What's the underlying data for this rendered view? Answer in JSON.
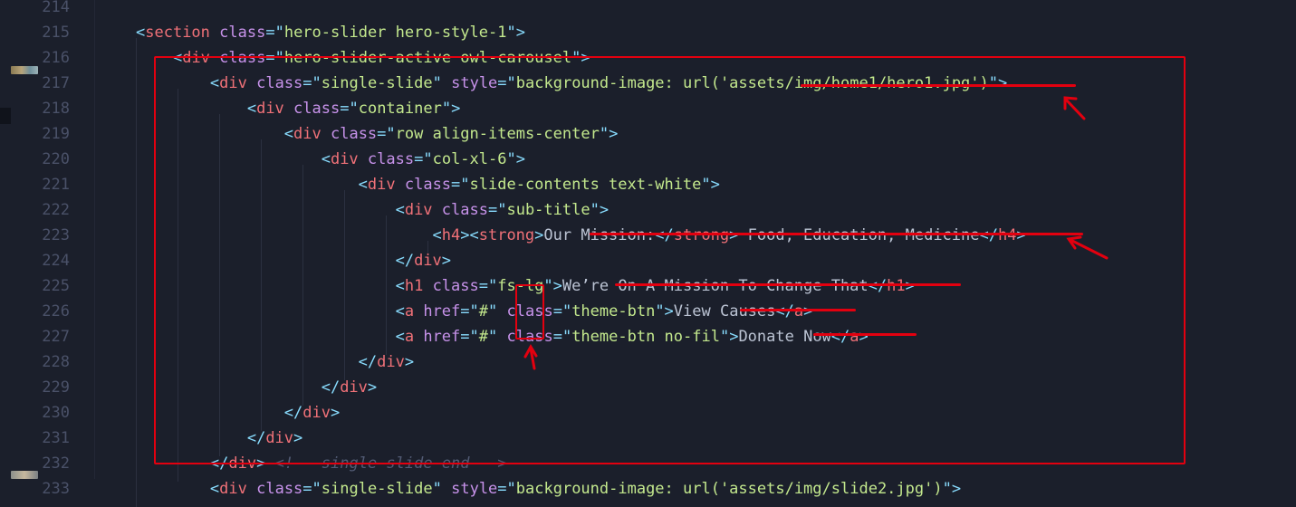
{
  "editor": {
    "theme_colors": {
      "background": "#1b1f2b",
      "line_number": "#4a5168",
      "punctuation": "#89ddff",
      "tag": "#f07178",
      "attribute": "#c792ea",
      "string": "#c3e88d",
      "text": "#bcc4d4",
      "comment": "#525b74",
      "annotation": "#e3000f"
    },
    "lines": [
      {
        "number": "214",
        "tokens": []
      },
      {
        "number": "215",
        "tokens": [
          [
            "pun",
            "<"
          ],
          [
            "tag",
            "section"
          ],
          [
            "txt",
            " "
          ],
          [
            "att",
            "class"
          ],
          [
            "pun",
            "=\""
          ],
          [
            "str",
            "hero-slider hero-style-1"
          ],
          [
            "pun",
            "\">"
          ]
        ]
      },
      {
        "number": "216",
        "tokens": [
          [
            "txt",
            "    "
          ],
          [
            "pun",
            "<"
          ],
          [
            "tag",
            "div"
          ],
          [
            "txt",
            " "
          ],
          [
            "att",
            "class"
          ],
          [
            "pun",
            "=\""
          ],
          [
            "str",
            "hero-slider-active owl-carousel"
          ],
          [
            "pun",
            "\">"
          ]
        ]
      },
      {
        "number": "217",
        "tokens": [
          [
            "txt",
            "        "
          ],
          [
            "pun",
            "<"
          ],
          [
            "tag",
            "div"
          ],
          [
            "txt",
            " "
          ],
          [
            "att",
            "class"
          ],
          [
            "pun",
            "=\""
          ],
          [
            "str",
            "single-slide"
          ],
          [
            "pun",
            "\""
          ],
          [
            "txt",
            " "
          ],
          [
            "att",
            "style"
          ],
          [
            "pun",
            "=\""
          ],
          [
            "str",
            "background-image: url('assets/img/home1/hero1.jpg')"
          ],
          [
            "pun",
            "\">"
          ]
        ]
      },
      {
        "number": "218",
        "tokens": [
          [
            "txt",
            "            "
          ],
          [
            "pun",
            "<"
          ],
          [
            "tag",
            "div"
          ],
          [
            "txt",
            " "
          ],
          [
            "att",
            "class"
          ],
          [
            "pun",
            "=\""
          ],
          [
            "str",
            "container"
          ],
          [
            "pun",
            "\">"
          ]
        ]
      },
      {
        "number": "219",
        "tokens": [
          [
            "txt",
            "                "
          ],
          [
            "pun",
            "<"
          ],
          [
            "tag",
            "div"
          ],
          [
            "txt",
            " "
          ],
          [
            "att",
            "class"
          ],
          [
            "pun",
            "=\""
          ],
          [
            "str",
            "row align-items-center"
          ],
          [
            "pun",
            "\">"
          ]
        ]
      },
      {
        "number": "220",
        "tokens": [
          [
            "txt",
            "                    "
          ],
          [
            "pun",
            "<"
          ],
          [
            "tag",
            "div"
          ],
          [
            "txt",
            " "
          ],
          [
            "att",
            "class"
          ],
          [
            "pun",
            "=\""
          ],
          [
            "str",
            "col-xl-6"
          ],
          [
            "pun",
            "\">"
          ]
        ]
      },
      {
        "number": "221",
        "tokens": [
          [
            "txt",
            "                        "
          ],
          [
            "pun",
            "<"
          ],
          [
            "tag",
            "div"
          ],
          [
            "txt",
            " "
          ],
          [
            "att",
            "class"
          ],
          [
            "pun",
            "=\""
          ],
          [
            "str",
            "slide-contents text-white"
          ],
          [
            "pun",
            "\">"
          ]
        ]
      },
      {
        "number": "222",
        "tokens": [
          [
            "txt",
            "                            "
          ],
          [
            "pun",
            "<"
          ],
          [
            "tag",
            "div"
          ],
          [
            "txt",
            " "
          ],
          [
            "att",
            "class"
          ],
          [
            "pun",
            "=\""
          ],
          [
            "str",
            "sub-title"
          ],
          [
            "pun",
            "\">"
          ]
        ]
      },
      {
        "number": "223",
        "tokens": [
          [
            "txt",
            "                                "
          ],
          [
            "pun",
            "<"
          ],
          [
            "tag",
            "h4"
          ],
          [
            "pun",
            "><"
          ],
          [
            "tag",
            "strong"
          ],
          [
            "pun",
            ">"
          ],
          [
            "txt",
            "Our Mission:"
          ],
          [
            "pun",
            "</"
          ],
          [
            "tag",
            "strong"
          ],
          [
            "pun",
            ">"
          ],
          [
            "txt",
            " Food, Education, Medicine"
          ],
          [
            "pun",
            "</"
          ],
          [
            "tag",
            "h4"
          ],
          [
            "pun",
            ">"
          ]
        ]
      },
      {
        "number": "224",
        "tokens": [
          [
            "txt",
            "                            "
          ],
          [
            "pun",
            "</"
          ],
          [
            "tag",
            "div"
          ],
          [
            "pun",
            ">"
          ]
        ]
      },
      {
        "number": "225",
        "tokens": [
          [
            "txt",
            "                            "
          ],
          [
            "pun",
            "<"
          ],
          [
            "tag",
            "h1"
          ],
          [
            "txt",
            " "
          ],
          [
            "att",
            "class"
          ],
          [
            "pun",
            "=\""
          ],
          [
            "str",
            "fs-lg"
          ],
          [
            "pun",
            "\">"
          ],
          [
            "txt",
            "We’re On A Mission To Change That"
          ],
          [
            "pun",
            "</"
          ],
          [
            "tag",
            "h1"
          ],
          [
            "pun",
            ">"
          ]
        ]
      },
      {
        "number": "226",
        "tokens": [
          [
            "txt",
            "                            "
          ],
          [
            "pun",
            "<"
          ],
          [
            "tag",
            "a"
          ],
          [
            "txt",
            " "
          ],
          [
            "att",
            "href"
          ],
          [
            "pun",
            "=\""
          ],
          [
            "str",
            "#"
          ],
          [
            "pun",
            "\""
          ],
          [
            "txt",
            " "
          ],
          [
            "att",
            "class"
          ],
          [
            "pun",
            "=\""
          ],
          [
            "str",
            "theme-btn"
          ],
          [
            "pun",
            "\">"
          ],
          [
            "txt",
            "View Causes"
          ],
          [
            "pun",
            "</"
          ],
          [
            "tag",
            "a"
          ],
          [
            "pun",
            ">"
          ]
        ]
      },
      {
        "number": "227",
        "tokens": [
          [
            "txt",
            "                            "
          ],
          [
            "pun",
            "<"
          ],
          [
            "tag",
            "a"
          ],
          [
            "txt",
            " "
          ],
          [
            "att",
            "href"
          ],
          [
            "pun",
            "=\""
          ],
          [
            "str",
            "#"
          ],
          [
            "pun",
            "\""
          ],
          [
            "txt",
            " "
          ],
          [
            "att",
            "class"
          ],
          [
            "pun",
            "=\""
          ],
          [
            "str",
            "theme-btn no-fil"
          ],
          [
            "pun",
            "\">"
          ],
          [
            "txt",
            "Donate Now"
          ],
          [
            "pun",
            "</"
          ],
          [
            "tag",
            "a"
          ],
          [
            "pun",
            ">"
          ]
        ]
      },
      {
        "number": "228",
        "tokens": [
          [
            "txt",
            "                        "
          ],
          [
            "pun",
            "</"
          ],
          [
            "tag",
            "div"
          ],
          [
            "pun",
            ">"
          ]
        ]
      },
      {
        "number": "229",
        "tokens": [
          [
            "txt",
            "                    "
          ],
          [
            "pun",
            "</"
          ],
          [
            "tag",
            "div"
          ],
          [
            "pun",
            ">"
          ]
        ]
      },
      {
        "number": "230",
        "tokens": [
          [
            "txt",
            "                "
          ],
          [
            "pun",
            "</"
          ],
          [
            "tag",
            "div"
          ],
          [
            "pun",
            ">"
          ]
        ]
      },
      {
        "number": "231",
        "tokens": [
          [
            "txt",
            "            "
          ],
          [
            "pun",
            "</"
          ],
          [
            "tag",
            "div"
          ],
          [
            "pun",
            ">"
          ]
        ]
      },
      {
        "number": "232",
        "tokens": [
          [
            "txt",
            "        "
          ],
          [
            "pun",
            "</"
          ],
          [
            "tag",
            "div"
          ],
          [
            "pun",
            ">"
          ],
          [
            "txt",
            " "
          ],
          [
            "cmt",
            "<!-- single-slide end -->"
          ]
        ]
      },
      {
        "number": "233",
        "tokens": [
          [
            "txt",
            "        "
          ],
          [
            "pun",
            "<"
          ],
          [
            "tag",
            "div"
          ],
          [
            "txt",
            " "
          ],
          [
            "att",
            "class"
          ],
          [
            "pun",
            "=\""
          ],
          [
            "str",
            "single-slide"
          ],
          [
            "pun",
            "\""
          ],
          [
            "txt",
            " "
          ],
          [
            "att",
            "style"
          ],
          [
            "pun",
            "=\""
          ],
          [
            "str",
            "background-image: url('assets/img/slide2.jpg')"
          ],
          [
            "pun",
            "\">"
          ]
        ]
      }
    ]
  }
}
